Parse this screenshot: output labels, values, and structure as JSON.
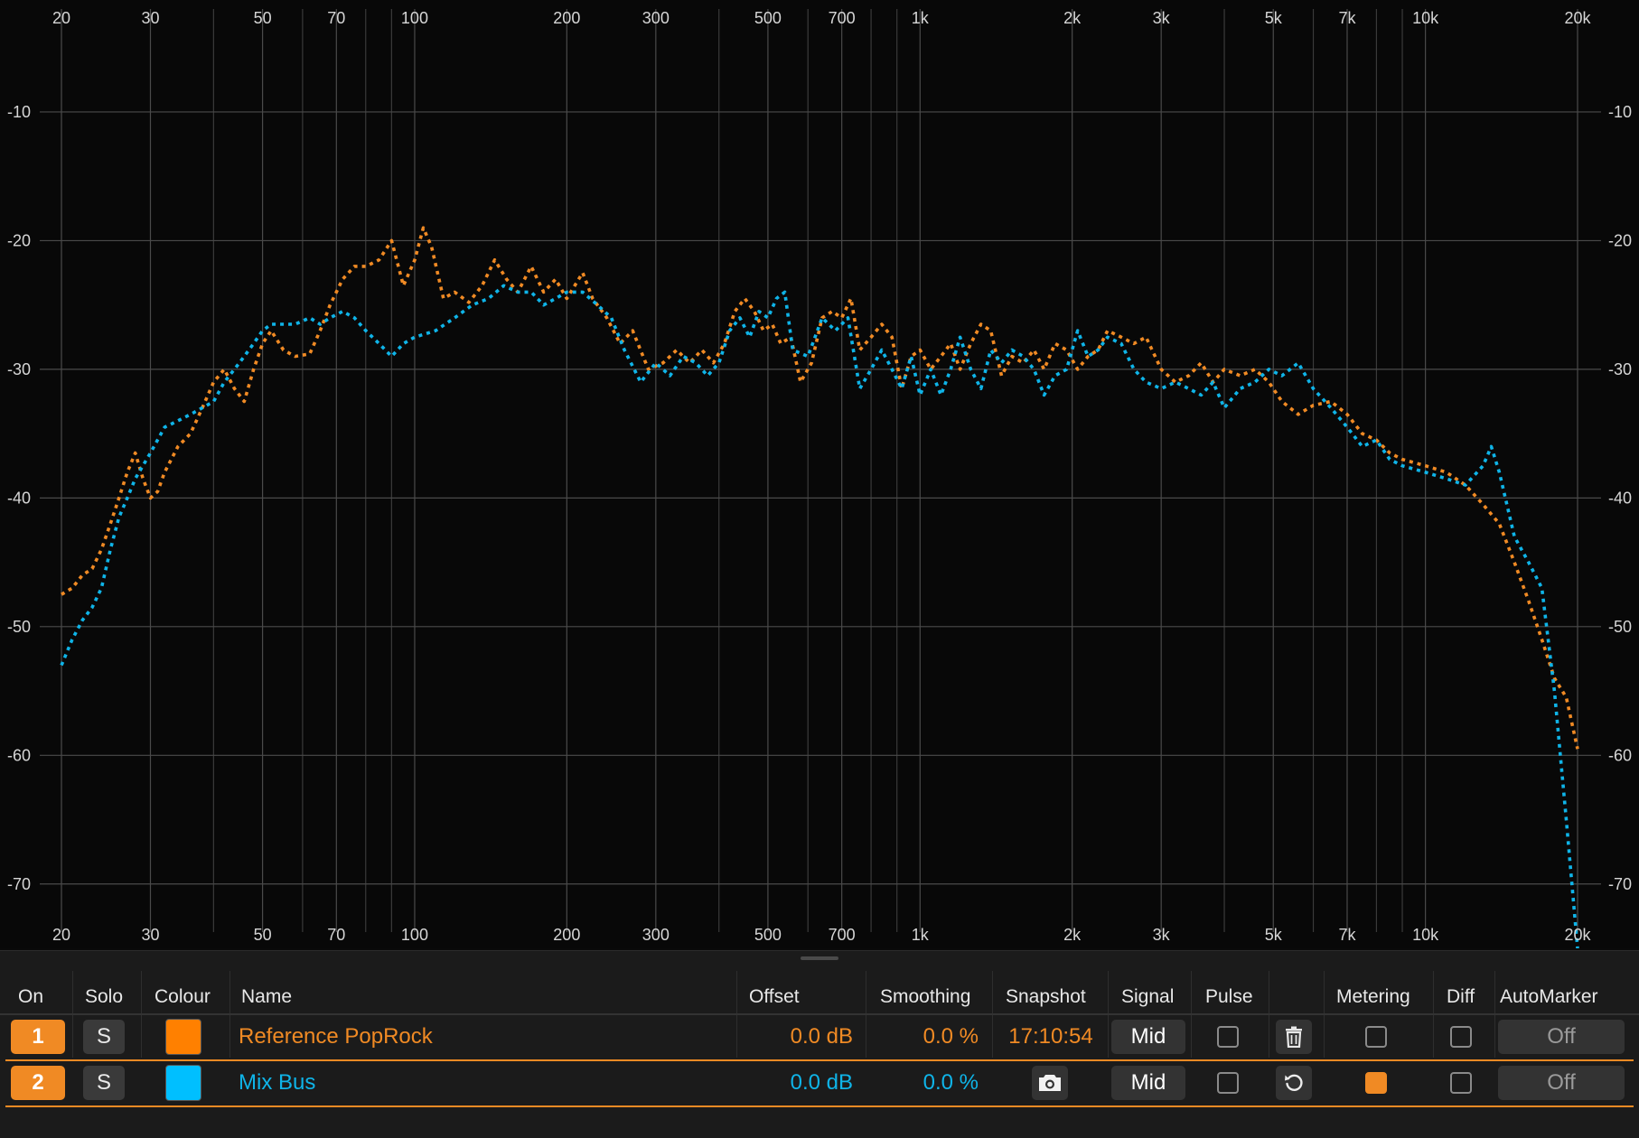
{
  "chart_data": {
    "type": "line",
    "x_scale": "log",
    "xlim": [
      20,
      20000
    ],
    "ylim": [
      -75,
      -1.3
    ],
    "grid": true,
    "x_ticks": [
      20,
      30,
      50,
      70,
      100,
      200,
      300,
      500,
      700,
      1000,
      2000,
      3000,
      5000,
      7000,
      10000,
      20000
    ],
    "x_tick_labels": [
      "20",
      "30",
      "50",
      "70",
      "100",
      "200",
      "300",
      "500",
      "700",
      "1k",
      "2k",
      "3k",
      "5k",
      "7k",
      "10k",
      "20k"
    ],
    "x_minor_gridlines": [
      40,
      60,
      80,
      90,
      400,
      600,
      800,
      900,
      4000,
      6000,
      8000,
      9000
    ],
    "y_ticks": [
      -10,
      -20,
      -30,
      -40,
      -50,
      -60,
      -70
    ],
    "y_tick_labels": [
      "-10",
      "-20",
      "-30",
      "-40",
      "-50",
      "-60",
      "-70"
    ],
    "series": [
      {
        "name": "Reference PopRock",
        "color": "#f08a24",
        "style": "dotted",
        "points": [
          [
            20,
            -47.5
          ],
          [
            21,
            -47
          ],
          [
            22,
            -46
          ],
          [
            23,
            -45.5
          ],
          [
            24,
            -44
          ],
          [
            25,
            -42
          ],
          [
            26,
            -40
          ],
          [
            27,
            -38
          ],
          [
            28,
            -36.5
          ],
          [
            29,
            -38.5
          ],
          [
            30,
            -40
          ],
          [
            31,
            -39.5
          ],
          [
            32,
            -38
          ],
          [
            33,
            -37
          ],
          [
            34,
            -36
          ],
          [
            35,
            -35.5
          ],
          [
            36,
            -35
          ],
          [
            37,
            -34
          ],
          [
            38,
            -33
          ],
          [
            40,
            -31
          ],
          [
            42,
            -30
          ],
          [
            44,
            -31.5
          ],
          [
            46,
            -32.5
          ],
          [
            48,
            -30
          ],
          [
            50,
            -28
          ],
          [
            52,
            -27
          ],
          [
            55,
            -28.5
          ],
          [
            58,
            -29
          ],
          [
            62,
            -28.8
          ],
          [
            65,
            -27
          ],
          [
            68,
            -25
          ],
          [
            72,
            -23
          ],
          [
            76,
            -22
          ],
          [
            80,
            -22
          ],
          [
            85,
            -21.5
          ],
          [
            90,
            -20
          ],
          [
            95,
            -23.5
          ],
          [
            100,
            -21.5
          ],
          [
            104,
            -19
          ],
          [
            108,
            -20.5
          ],
          [
            114,
            -24.5
          ],
          [
            120,
            -24
          ],
          [
            128,
            -24.8
          ],
          [
            136,
            -23.5
          ],
          [
            144,
            -21.5
          ],
          [
            152,
            -23
          ],
          [
            160,
            -24
          ],
          [
            170,
            -22
          ],
          [
            180,
            -24
          ],
          [
            190,
            -23
          ],
          [
            200,
            -24.5
          ],
          [
            215,
            -22.5
          ],
          [
            225,
            -24.5
          ],
          [
            240,
            -26
          ],
          [
            255,
            -28
          ],
          [
            270,
            -27
          ],
          [
            290,
            -30
          ],
          [
            310,
            -29.5
          ],
          [
            330,
            -28.5
          ],
          [
            350,
            -29.5
          ],
          [
            370,
            -28.5
          ],
          [
            390,
            -29.5
          ],
          [
            410,
            -28
          ],
          [
            430,
            -25.5
          ],
          [
            450,
            -24.5
          ],
          [
            470,
            -25.5
          ],
          [
            490,
            -27
          ],
          [
            510,
            -26.5
          ],
          [
            530,
            -28
          ],
          [
            555,
            -27.5
          ],
          [
            580,
            -31
          ],
          [
            610,
            -29.5
          ],
          [
            640,
            -26
          ],
          [
            670,
            -25.5
          ],
          [
            700,
            -26
          ],
          [
            730,
            -24.5
          ],
          [
            760,
            -28.5
          ],
          [
            800,
            -27.5
          ],
          [
            840,
            -26.5
          ],
          [
            880,
            -27.5
          ],
          [
            920,
            -31.5
          ],
          [
            960,
            -29
          ],
          [
            1000,
            -28.5
          ],
          [
            1050,
            -30
          ],
          [
            1100,
            -29
          ],
          [
            1150,
            -28
          ],
          [
            1200,
            -30
          ],
          [
            1260,
            -28
          ],
          [
            1320,
            -26.5
          ],
          [
            1380,
            -27
          ],
          [
            1450,
            -30.5
          ],
          [
            1520,
            -29
          ],
          [
            1600,
            -29.5
          ],
          [
            1680,
            -28.5
          ],
          [
            1760,
            -30
          ],
          [
            1850,
            -28
          ],
          [
            1950,
            -28.5
          ],
          [
            2050,
            -30
          ],
          [
            2150,
            -29
          ],
          [
            2250,
            -28.5
          ],
          [
            2350,
            -27
          ],
          [
            2500,
            -27.5
          ],
          [
            2650,
            -28
          ],
          [
            2800,
            -27.5
          ],
          [
            3000,
            -30
          ],
          [
            3200,
            -31
          ],
          [
            3400,
            -30.5
          ],
          [
            3600,
            -29.5
          ],
          [
            3800,
            -31
          ],
          [
            4000,
            -30
          ],
          [
            4300,
            -30.5
          ],
          [
            4600,
            -30
          ],
          [
            4900,
            -31
          ],
          [
            5200,
            -32.5
          ],
          [
            5600,
            -33.5
          ],
          [
            6000,
            -32.8
          ],
          [
            6500,
            -32.5
          ],
          [
            7000,
            -33.5
          ],
          [
            7500,
            -35
          ],
          [
            8000,
            -35.5
          ],
          [
            8500,
            -36.5
          ],
          [
            9000,
            -37
          ],
          [
            10000,
            -37.5
          ],
          [
            11000,
            -38
          ],
          [
            12000,
            -39
          ],
          [
            13000,
            -40.5
          ],
          [
            14000,
            -42
          ],
          [
            15000,
            -45
          ],
          [
            16000,
            -48
          ],
          [
            17000,
            -51
          ],
          [
            18000,
            -54
          ],
          [
            19000,
            -55.5
          ],
          [
            20000,
            -59.5
          ]
        ]
      },
      {
        "name": "Mix Bus",
        "color": "#0fb4e8",
        "style": "dotted",
        "points": [
          [
            20,
            -53
          ],
          [
            21,
            -51
          ],
          [
            22,
            -49.5
          ],
          [
            23,
            -48.5
          ],
          [
            24,
            -47
          ],
          [
            25,
            -44
          ],
          [
            26,
            -41.5
          ],
          [
            27,
            -40
          ],
          [
            28,
            -38.5
          ],
          [
            30,
            -36.5
          ],
          [
            32,
            -34.5
          ],
          [
            34,
            -34
          ],
          [
            36,
            -33.5
          ],
          [
            38,
            -33
          ],
          [
            40,
            -32.5
          ],
          [
            42,
            -31
          ],
          [
            44,
            -30
          ],
          [
            46,
            -29
          ],
          [
            48,
            -28
          ],
          [
            50,
            -27
          ],
          [
            52,
            -26.5
          ],
          [
            55,
            -26.5
          ],
          [
            58,
            -26.5
          ],
          [
            62,
            -26
          ],
          [
            65,
            -26.5
          ],
          [
            68,
            -26
          ],
          [
            72,
            -25.5
          ],
          [
            76,
            -26
          ],
          [
            80,
            -27
          ],
          [
            85,
            -28
          ],
          [
            90,
            -29
          ],
          [
            95,
            -28
          ],
          [
            100,
            -27.5
          ],
          [
            110,
            -27
          ],
          [
            120,
            -26
          ],
          [
            130,
            -25
          ],
          [
            140,
            -24.5
          ],
          [
            150,
            -23.5
          ],
          [
            160,
            -24
          ],
          [
            170,
            -24
          ],
          [
            180,
            -25
          ],
          [
            190,
            -24.5
          ],
          [
            200,
            -24
          ],
          [
            215,
            -24
          ],
          [
            230,
            -25
          ],
          [
            245,
            -26
          ],
          [
            260,
            -28.5
          ],
          [
            280,
            -31
          ],
          [
            300,
            -29.5
          ],
          [
            320,
            -30.5
          ],
          [
            340,
            -29
          ],
          [
            360,
            -29.5
          ],
          [
            380,
            -30.5
          ],
          [
            400,
            -29.5
          ],
          [
            420,
            -27
          ],
          [
            440,
            -26
          ],
          [
            460,
            -27.5
          ],
          [
            480,
            -25.5
          ],
          [
            500,
            -26
          ],
          [
            520,
            -24.5
          ],
          [
            540,
            -24
          ],
          [
            560,
            -28.5
          ],
          [
            600,
            -29
          ],
          [
            640,
            -26
          ],
          [
            680,
            -27
          ],
          [
            720,
            -26
          ],
          [
            760,
            -31.5
          ],
          [
            800,
            -30
          ],
          [
            840,
            -28.5
          ],
          [
            880,
            -30
          ],
          [
            920,
            -31.5
          ],
          [
            960,
            -29
          ],
          [
            1000,
            -32
          ],
          [
            1050,
            -30
          ],
          [
            1100,
            -32
          ],
          [
            1150,
            -30
          ],
          [
            1200,
            -27.5
          ],
          [
            1260,
            -30
          ],
          [
            1320,
            -31.5
          ],
          [
            1380,
            -28.5
          ],
          [
            1450,
            -29.5
          ],
          [
            1520,
            -28.5
          ],
          [
            1600,
            -29
          ],
          [
            1680,
            -30
          ],
          [
            1760,
            -32
          ],
          [
            1850,
            -30.5
          ],
          [
            1950,
            -30
          ],
          [
            2050,
            -27
          ],
          [
            2150,
            -29
          ],
          [
            2250,
            -28.5
          ],
          [
            2350,
            -27.5
          ],
          [
            2500,
            -28
          ],
          [
            2650,
            -30
          ],
          [
            2800,
            -31
          ],
          [
            3000,
            -31.5
          ],
          [
            3200,
            -31
          ],
          [
            3400,
            -31.5
          ],
          [
            3600,
            -32
          ],
          [
            3800,
            -31
          ],
          [
            4000,
            -33
          ],
          [
            4300,
            -31.5
          ],
          [
            4600,
            -31
          ],
          [
            4900,
            -30
          ],
          [
            5200,
            -30.5
          ],
          [
            5600,
            -29.5
          ],
          [
            6000,
            -31.5
          ],
          [
            6500,
            -33
          ],
          [
            7000,
            -34.5
          ],
          [
            7500,
            -36
          ],
          [
            8000,
            -35.5
          ],
          [
            8500,
            -37
          ],
          [
            9000,
            -37.5
          ],
          [
            10000,
            -38
          ],
          [
            11000,
            -38.5
          ],
          [
            12000,
            -39
          ],
          [
            13000,
            -37.5
          ],
          [
            13500,
            -36
          ],
          [
            14000,
            -38
          ],
          [
            15000,
            -43
          ],
          [
            16000,
            -45
          ],
          [
            17000,
            -47
          ],
          [
            18000,
            -55
          ],
          [
            19000,
            -65
          ],
          [
            20000,
            -75
          ]
        ]
      }
    ]
  },
  "table": {
    "headers": {
      "on": "On",
      "solo": "Solo",
      "colour": "Colour",
      "name": "Name",
      "offset": "Offset",
      "smoothing": "Smoothing",
      "snapshot": "Snapshot",
      "signal": "Signal",
      "pulse": "Pulse",
      "metering": "Metering",
      "diff": "Diff",
      "automarker": "AutoMarker"
    },
    "rows": [
      {
        "number": "1",
        "solo": "S",
        "colour": "#ff8000",
        "name": "Reference PopRock",
        "text_color": "#f08a24",
        "offset": "0.0 dB",
        "smoothing": "0.0 %",
        "snapshot": "17:10:54",
        "signal": "Mid",
        "pulse": false,
        "action_icon": "trash-icon",
        "metering": false,
        "diff": false,
        "automarker": "Off"
      },
      {
        "number": "2",
        "solo": "S",
        "colour": "#00bfff",
        "name": "Mix Bus",
        "text_color": "#0fb4e8",
        "offset": "0.0 dB",
        "smoothing": "0.0 %",
        "snapshot_icon": "camera-icon",
        "signal": "Mid",
        "pulse": false,
        "action_icon": "reset-icon",
        "metering": true,
        "diff": false,
        "automarker": "Off"
      }
    ]
  }
}
